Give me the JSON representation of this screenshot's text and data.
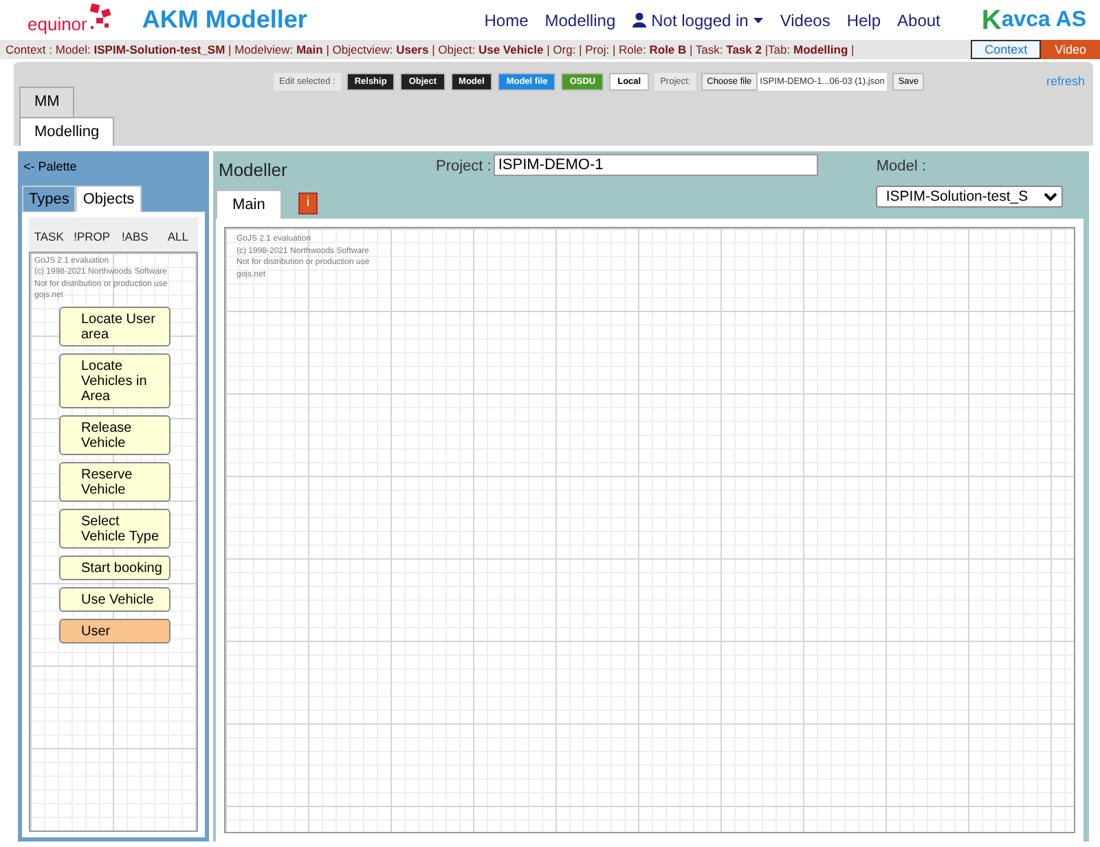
{
  "header": {
    "brand_logo_text": "equinor",
    "title": "AKM Modeller",
    "nav": [
      {
        "label": "Home",
        "kind": "link"
      },
      {
        "label": "Modelling",
        "kind": "link"
      },
      {
        "label": "Not logged in",
        "kind": "user-dropdown"
      },
      {
        "label": "Videos",
        "kind": "link"
      },
      {
        "label": "Help",
        "kind": "link"
      },
      {
        "label": "About",
        "kind": "link"
      }
    ],
    "partner_logo": {
      "letter": "K",
      "text": "avca AS"
    }
  },
  "context_bar": {
    "text": "Context : Model: **ISPIM-Solution-test_SM** | Modelview: **Main** | Objectview: **Users** | Object: **Use Vehicle** | Org: | Proj: | Role: **Role B** | Task: **Task 2** |Tab: **Modelling** |",
    "buttons": [
      {
        "label": "Context",
        "kind": "outline"
      },
      {
        "label": "Video",
        "kind": "accent"
      }
    ]
  },
  "toolbar": {
    "label": "Edit selected :",
    "buttons": [
      {
        "label": "Relship",
        "kind": "dark"
      },
      {
        "label": "Object",
        "kind": "dark"
      },
      {
        "label": "Model",
        "kind": "dark"
      },
      {
        "label": "Model file",
        "kind": "blue"
      },
      {
        "label": "OSDU",
        "kind": "green"
      },
      {
        "label": "Local",
        "kind": "light"
      }
    ],
    "project_label": "Project:",
    "file_button": "Choose file",
    "file_name": "ISPIM-DEMO-1...06-03 (1).json",
    "save_button": "Save",
    "refresh": "refresh"
  },
  "main_tabs": [
    {
      "label": "MM",
      "selected": false
    },
    {
      "label": "Modelling",
      "selected": true
    }
  ],
  "palette": {
    "title": "<- Palette",
    "tabs": [
      {
        "label": "Types",
        "selected": false
      },
      {
        "label": "Objects",
        "selected": true
      }
    ],
    "filters": [
      "TASK",
      "!PROP",
      "!ABS",
      "ALL"
    ],
    "watermark": [
      "GoJS 2.1 evaluation",
      "(c) 1998-2021 Northwoods Software",
      "Not for distribution or production use",
      "gojs.net"
    ],
    "nodes": [
      {
        "label": "Locate User area",
        "color": "#ffffd6"
      },
      {
        "label": "Locate Vehicles in Area",
        "color": "#ffffd6"
      },
      {
        "label": "Release Vehicle",
        "color": "#ffffd6"
      },
      {
        "label": "Reserve Vehicle",
        "color": "#ffffd6"
      },
      {
        "label": "Select Vehicle Type",
        "color": "#ffffd6"
      },
      {
        "label": "Start booking",
        "color": "#ffffd6"
      },
      {
        "label": "Use Vehicle",
        "color": "#ffffd6"
      },
      {
        "label": "User",
        "color": "#fac38d"
      }
    ]
  },
  "modeller": {
    "title": "Modeller",
    "project_label": "Project :",
    "project_value": "ISPIM-DEMO-1",
    "model_label": "Model :",
    "model_value": "ISPIM-Solution-test_S",
    "tabs": [
      {
        "label": "Main",
        "selected": true
      }
    ],
    "info_button": "i",
    "watermark": [
      "GoJS 2.1 evaluation",
      "(c) 1998-2021 Northwoods Software",
      "Not for distribution or production use",
      "gojs.net"
    ]
  }
}
